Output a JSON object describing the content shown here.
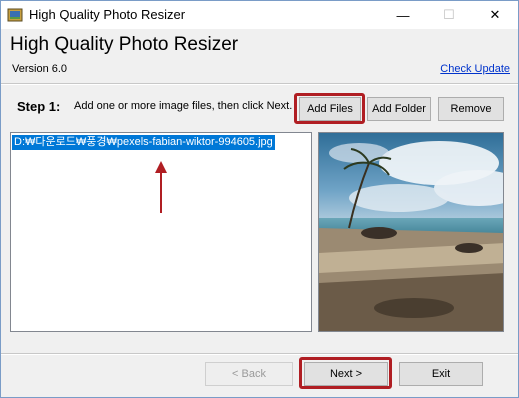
{
  "window": {
    "title": "High Quality Photo Resizer",
    "minimize_glyph": "—",
    "maximize_glyph": "☐",
    "close_glyph": "✕"
  },
  "header": {
    "title": "High Quality Photo Resizer",
    "version": "Version 6.0",
    "check_update": "Check Update"
  },
  "step": {
    "label": "Step 1:",
    "instruction": "Add one or more image files, then click Next."
  },
  "toolbar": {
    "add_files": "Add Files",
    "add_folder": "Add Folder",
    "remove": "Remove"
  },
  "file_list": {
    "items": [
      "D:₩다운로드₩풍경₩pexels-fabian-wiktor-994605.jpg"
    ]
  },
  "footer": {
    "back": "< Back",
    "next": "Next >",
    "exit": "Exit"
  },
  "colors": {
    "accent_highlight": "#b01e23",
    "selection": "#0078d7",
    "link": "#0033cc"
  }
}
